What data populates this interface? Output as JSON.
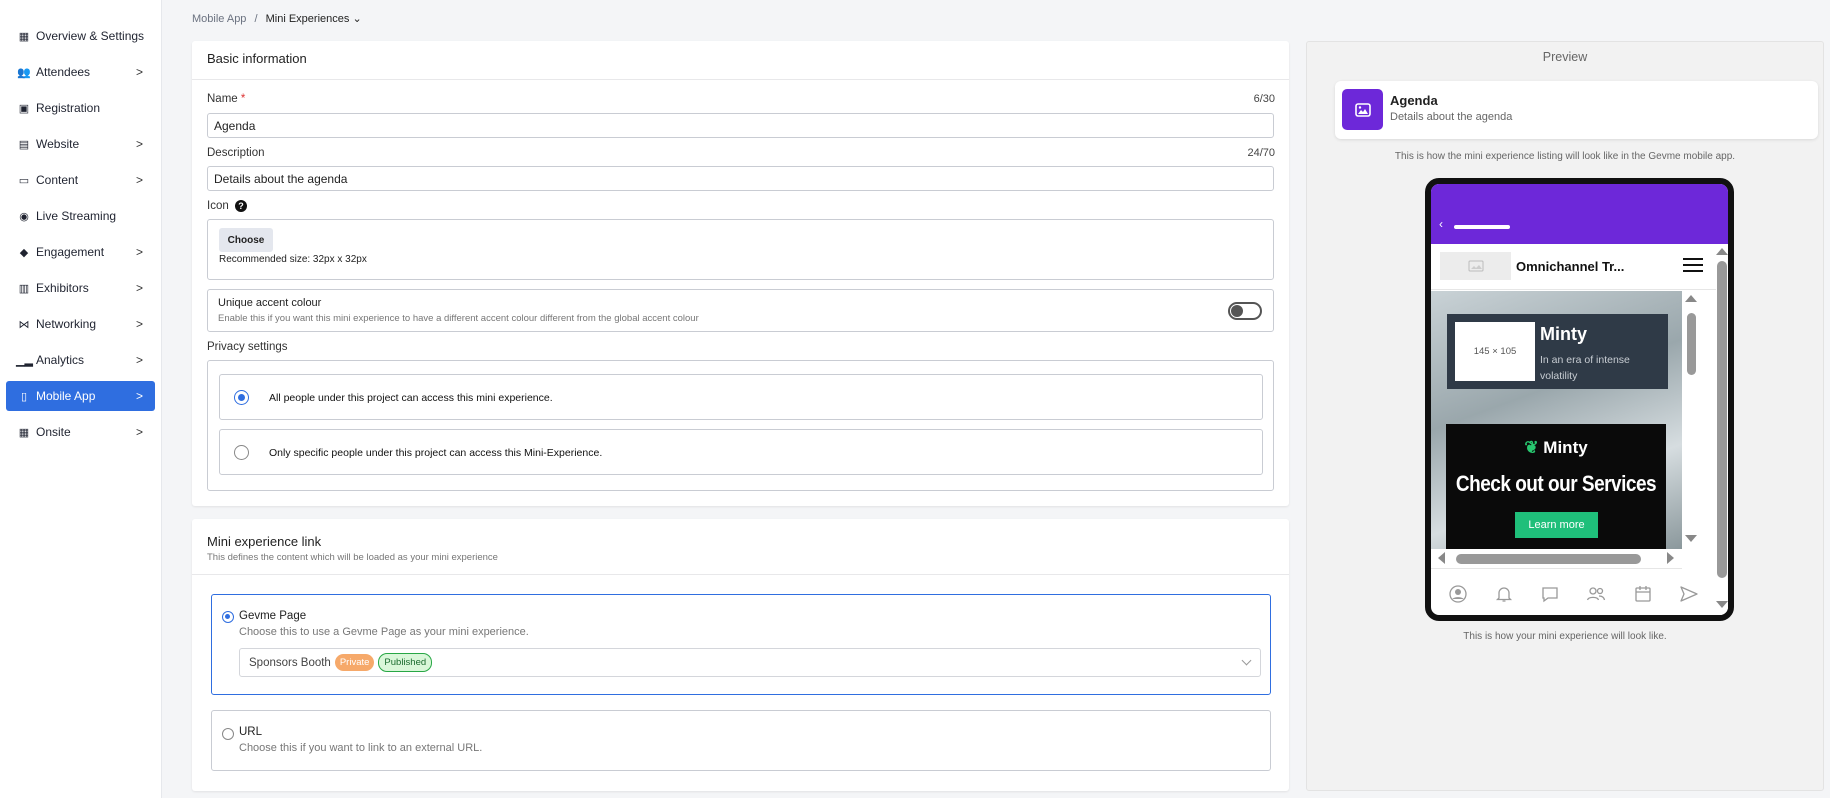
{
  "sidebar": {
    "items": [
      {
        "label": "Overview & Settings",
        "icon": "grid-icon",
        "chevron": ""
      },
      {
        "label": "Attendees",
        "icon": "people-icon",
        "chevron": ">"
      },
      {
        "label": "Registration",
        "icon": "id-card-icon",
        "chevron": ""
      },
      {
        "label": "Website",
        "icon": "browser-icon",
        "chevron": ">"
      },
      {
        "label": "Content",
        "icon": "folder-icon",
        "chevron": ">"
      },
      {
        "label": "Live Streaming",
        "icon": "broadcast-icon",
        "chevron": ""
      },
      {
        "label": "Engagement",
        "icon": "megaphone-icon",
        "chevron": ">"
      },
      {
        "label": "Exhibitors",
        "icon": "store-icon",
        "chevron": ">"
      },
      {
        "label": "Networking",
        "icon": "share-icon",
        "chevron": ">"
      },
      {
        "label": "Analytics",
        "icon": "chart-icon",
        "chevron": ">"
      },
      {
        "label": "Mobile App",
        "icon": "phone-icon",
        "chevron": ">"
      },
      {
        "label": "Onsite",
        "icon": "grid-icon",
        "chevron": ">"
      }
    ],
    "active_index": 10
  },
  "breadcrumb": {
    "parent": "Mobile App",
    "sep": "/",
    "current": "Mini Experiences",
    "caret": "⌄"
  },
  "basic": {
    "title": "Basic information",
    "name_label": "Name",
    "required_mark": "*",
    "name_count": "6/30",
    "name_value": "Agenda",
    "desc_label": "Description",
    "desc_count": "24/70",
    "desc_value": "Details about the agenda",
    "icon_label": "Icon",
    "help_glyph": "?",
    "choose_label": "Choose",
    "recommended": "Recommended size: 32px x 32px",
    "accent_title": "Unique accent colour",
    "accent_desc": "Enable this if you want this mini experience to have a different accent colour different from the global accent colour",
    "accent_enabled": false,
    "privacy_label": "Privacy settings",
    "privacy_opt1": "All people under this project can access this mini experience.",
    "privacy_opt2": "Only specific people under this project can access this Mini-Experience."
  },
  "link": {
    "title": "Mini experience link",
    "subtitle": "This defines the content which will be loaded as your mini experience",
    "opt1_title": "Gevme Page",
    "opt1_desc": "Choose this to use a Gevme Page as your mini experience.",
    "select_value": "Sponsors Booth",
    "badge_private": "Private",
    "badge_published": "Published",
    "opt2_title": "URL",
    "opt2_desc": "Choose this if you want to link to an external URL."
  },
  "preview": {
    "title": "Preview",
    "item_title": "Agenda",
    "item_desc": "Details about the agenda",
    "listing_note": "This is how the mini experience listing will look like in the Gevme mobile app.",
    "phone_note": "This is how your mini experience will look like.",
    "phone": {
      "back": "‹",
      "app_title": "Omnichannel Tr...",
      "placeholder_size": "145 × 105",
      "ad1_title": "Minty",
      "ad1_text": "In an era of intense volatility",
      "ad2_brand": "Minty",
      "ad2_headline": "Check out our Services",
      "ad2_button": "Learn more"
    }
  },
  "colors": {
    "accent": "#2f6ee0",
    "purple": "#6d28d9",
    "private": "#f6a96a",
    "published": "#d9f7d9",
    "cta": "#1fbf7a"
  }
}
